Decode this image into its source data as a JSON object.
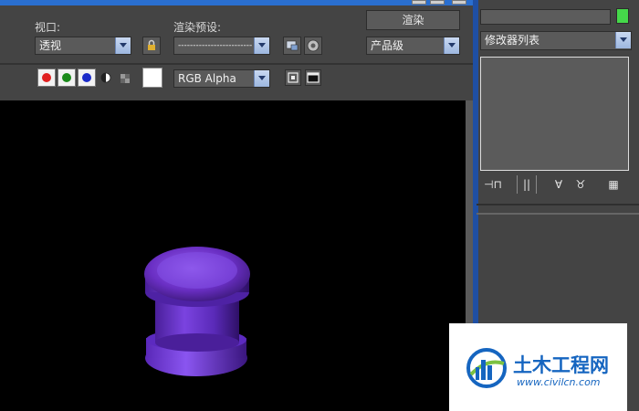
{
  "toolbar": {
    "viewport_label": "视口:",
    "viewport_value": "透视",
    "preset_label": "渲染预设:",
    "preset_value": "-------------------------",
    "render_button": "渲染",
    "quality_value": "产品级",
    "channel_value": "RGB Alpha"
  },
  "panel": {
    "modifier_list": "修改器列表"
  },
  "watermark": {
    "brand": "土木工程网",
    "url": "www.civilcn.com"
  },
  "colors": {
    "object": "#6a2fc4",
    "swatch": "#45d84a"
  }
}
